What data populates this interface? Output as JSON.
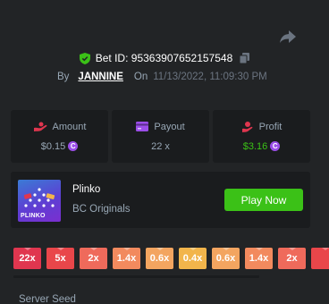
{
  "bet": {
    "id_label": "Bet ID:",
    "id_value": "95363907652157548",
    "by_label": "By",
    "username": "JANNINE",
    "on_label": "On",
    "datetime": "11/13/2022, 11:09:30 PM"
  },
  "stats": {
    "amount": {
      "label": "Amount",
      "value": "$0.15",
      "icon": "amount-icon"
    },
    "payout": {
      "label": "Payout",
      "value": "22 x",
      "icon": "payout-icon"
    },
    "profit": {
      "label": "Profit",
      "value": "$3.16",
      "icon": "profit-icon"
    }
  },
  "coin_glyph": "C",
  "game": {
    "title": "Plinko",
    "provider": "BC Originals",
    "thumb_text": "PLINKO",
    "play_label": "Play Now"
  },
  "multipliers": [
    {
      "label": "22x",
      "color": "#e0364f"
    },
    {
      "label": "5x",
      "color": "#e9464a"
    },
    {
      "label": "2x",
      "color": "#ef6a5b"
    },
    {
      "label": "1.4x",
      "color": "#f28a5e"
    },
    {
      "label": "0.6x",
      "color": "#f3a560"
    },
    {
      "label": "0.4x",
      "color": "#f2b54b"
    },
    {
      "label": "0.6x",
      "color": "#f3a560"
    },
    {
      "label": "1.4x",
      "color": "#f28a5e"
    },
    {
      "label": "2x",
      "color": "#ef6a5b"
    }
  ],
  "seed_label": "Server Seed",
  "colors": {
    "background": "#222426",
    "panel": "#1a1c1e",
    "accent_green": "#3bc117",
    "coin_purple": "#9b4ee8"
  }
}
